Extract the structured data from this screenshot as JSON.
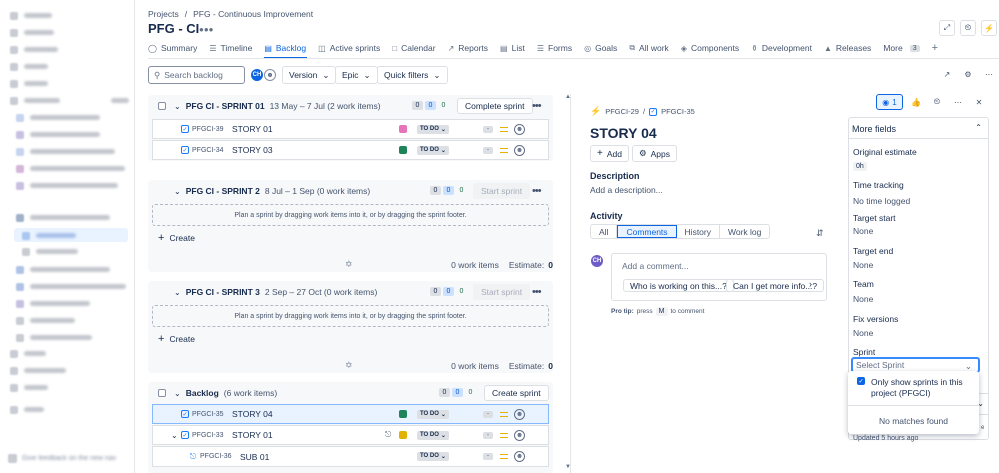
{
  "sidebar": {
    "feedback_label": "Give feedback on the new nav"
  },
  "breadcrumb": {
    "root": "Projects",
    "sep": "/",
    "project": "PFG - Continuous Improvement"
  },
  "page": {
    "title": "PFG - CI"
  },
  "tabs": [
    {
      "label": "Summary",
      "icon": "globe-icon"
    },
    {
      "label": "Timeline",
      "icon": "timeline-icon"
    },
    {
      "label": "Backlog",
      "icon": "backlog-icon"
    },
    {
      "label": "Active sprints",
      "icon": "board-icon"
    },
    {
      "label": "Calendar",
      "icon": "calendar-icon"
    },
    {
      "label": "Reports",
      "icon": "chart-icon"
    },
    {
      "label": "List",
      "icon": "list-icon"
    },
    {
      "label": "Forms",
      "icon": "forms-icon"
    },
    {
      "label": "Goals",
      "icon": "goals-icon"
    },
    {
      "label": "All work",
      "icon": "stack-icon"
    },
    {
      "label": "Components",
      "icon": "components-icon"
    },
    {
      "label": "Development",
      "icon": "branch-icon"
    },
    {
      "label": "Releases",
      "icon": "ship-icon"
    }
  ],
  "more_tab": {
    "label": "More",
    "count": "3"
  },
  "toolbar": {
    "search_placeholder": "Search backlog",
    "avatar_initials": "CH",
    "version_label": "Version",
    "epic_label": "Epic",
    "quick_filters_label": "Quick filters"
  },
  "sprints": [
    {
      "title": "PFG CI - SPRINT 01",
      "meta": "13 May – 7 Jul (2 work items)",
      "counts": [
        "0",
        "0",
        "0"
      ],
      "action": "Complete sprint",
      "items": [
        {
          "key": "PFGCI-39",
          "title": "STORY 01",
          "epic_color": "#e774bb",
          "status": "TO DO"
        },
        {
          "key": "PFGCI-34",
          "title": "STORY 03",
          "epic_color": "#1f845a",
          "status": "TO DO"
        }
      ]
    },
    {
      "title": "PFG CI - SPRINT 2",
      "meta": "8 Jul – 1 Sep (0 work items)",
      "counts": [
        "0",
        "0",
        "0"
      ],
      "action": "Start sprint",
      "empty_text": "Plan a sprint by dragging work items into it, or by dragging the sprint footer.",
      "create_label": "Create",
      "footer_count": "0 work items",
      "footer_estimate_label": "Estimate:",
      "footer_estimate": "0"
    },
    {
      "title": "PFG CI - SPRINT 3",
      "meta": "2 Sep – 27 Oct (0 work items)",
      "counts": [
        "0",
        "0",
        "0"
      ],
      "action": "Start sprint",
      "empty_text": "Plan a sprint by dragging work items into it, or by dragging the sprint footer.",
      "create_label": "Create",
      "footer_count": "0 work items",
      "footer_estimate_label": "Estimate:",
      "footer_estimate": "0"
    }
  ],
  "backlog": {
    "title": "Backlog",
    "meta": "(6 work items)",
    "counts": [
      "0",
      "0",
      "0"
    ],
    "action": "Create sprint",
    "items": [
      {
        "key": "PFGCI-35",
        "title": "STORY 04",
        "epic_color": "#1f845a",
        "status": "TO DO"
      },
      {
        "key": "PFGCI-33",
        "title": "STORY 01",
        "epic_color": "#e2b203",
        "status": "TO DO"
      },
      {
        "key": "PFGCI-36",
        "title": "SUB 01",
        "status": "TO DO"
      }
    ]
  },
  "detail": {
    "parent_key": "PFGCI-29",
    "key": "PFGCI-35",
    "title": "STORY 04",
    "add_label": "Add",
    "apps_label": "Apps",
    "watch_count": "1",
    "description_label": "Description",
    "description_placeholder": "Add a description...",
    "activity_label": "Activity",
    "activity_tabs": [
      "All",
      "Comments",
      "History",
      "Work log"
    ],
    "avatar_initials": "CH",
    "comment_placeholder": "Add a comment...",
    "suggestion_1": "Who is working on this...?",
    "suggestion_2": "Can I get more info...?",
    "pro_tip_label": "Pro tip:",
    "pro_tip_text_1": "press",
    "pro_tip_key": "M",
    "pro_tip_text_2": "to comment"
  },
  "fields": {
    "header": "More fields",
    "items": [
      {
        "label": "Original estimate",
        "value": "0h"
      },
      {
        "label": "Time tracking",
        "value": "No time logged"
      },
      {
        "label": "Target start",
        "value": "None"
      },
      {
        "label": "Target end",
        "value": "None"
      },
      {
        "label": "Team",
        "value": "None"
      },
      {
        "label": "Fix versions",
        "value": "None"
      },
      {
        "label": "Sprint"
      }
    ],
    "sprint_placeholder": "Select Sprint",
    "dropdown_option": "Only show sprints in this project (PFGCI)",
    "no_matches": "No matches found",
    "updated": "Updated 5 hours ago"
  }
}
